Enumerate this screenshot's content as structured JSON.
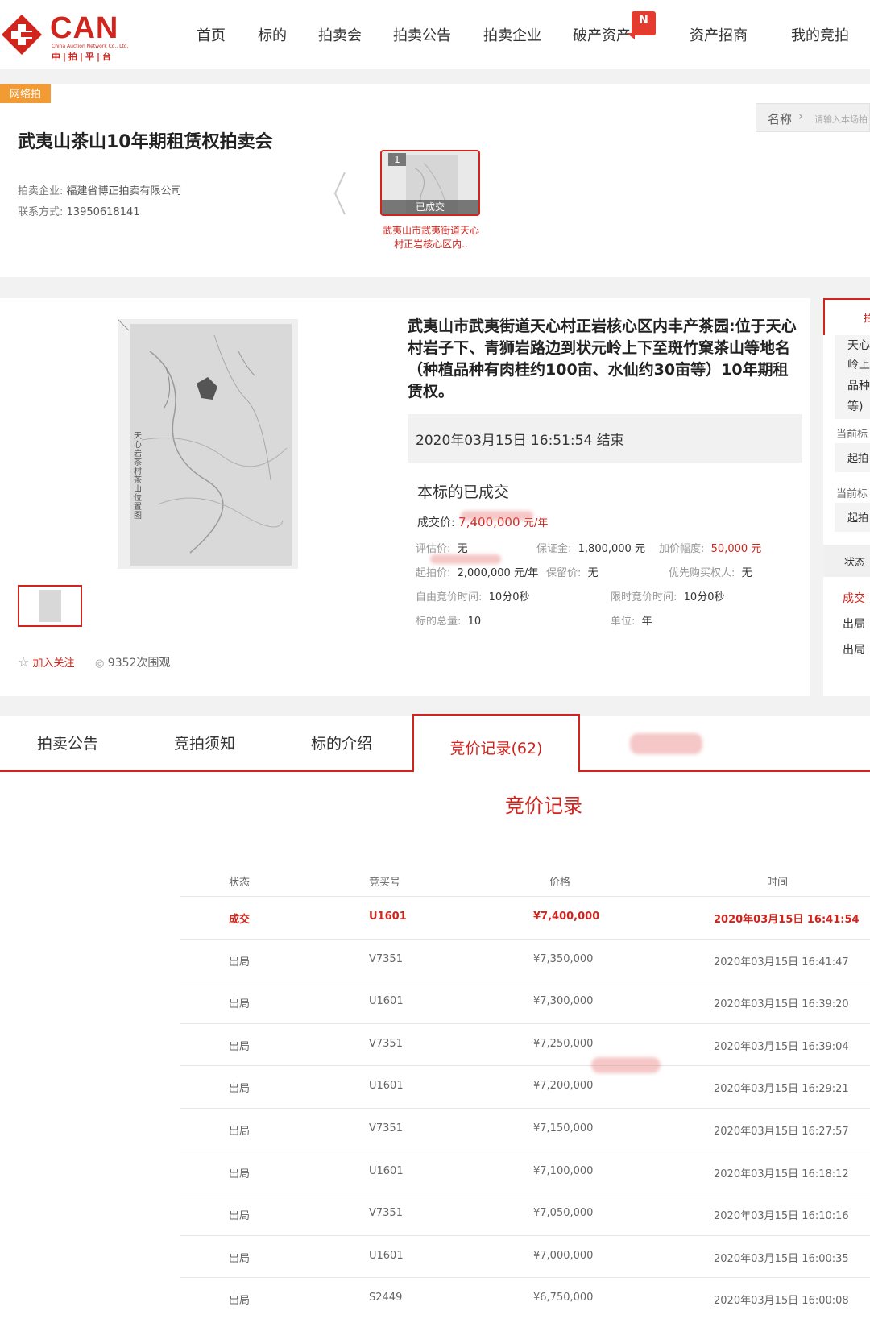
{
  "header": {
    "logo_text": "CAN",
    "logo_sub": "China Auction Network Co., Ltd.",
    "logo_cn": "中|拍|平|台",
    "nav": [
      "首页",
      "标的",
      "拍卖会",
      "拍卖公告",
      "拍卖企业",
      "破产资产",
      "资产招商",
      "我的竞拍"
    ],
    "badge": "N"
  },
  "auction": {
    "tag": "网络拍",
    "title": "武夷山茶山10年期租赁权拍卖会",
    "company_label": "拍卖企业:",
    "company": "福建省博正拍卖有限公司",
    "contact_label": "联系方式:",
    "contact": "13950618141",
    "search_label": "名称",
    "search_placeholder": "请输入本场拍",
    "lot_no": "1",
    "lot_status": "已成交",
    "lot_caption": "武夷山市武夷街道天心村正岩核心区内.."
  },
  "item": {
    "image_caption": "天心岩茶村茶山位置图",
    "follow": "加入关注",
    "views": "9352次围观",
    "title": "武夷山市武夷街道天心村正岩核心区内丰产茶园:位于天心村岩子下、青狮岩路边到状元岭上下至斑竹窠茶山等地名（种植品种有肉桂约100亩、水仙约30亩等）10年期租赁权。",
    "end_time": "2020年03月15日  16:51:54 结束",
    "sold_heading": "本标的已成交",
    "deal_label": "成交价:",
    "deal_value": "7,400,000",
    "deal_unit": "元/年",
    "fields": {
      "eval_k": "评估价:",
      "eval_v": "无",
      "deposit_k": "保证金:",
      "deposit_v": "1,800,000 元",
      "step_k": "加价幅度:",
      "step_v": "50,000 元",
      "start_k": "起拍价:",
      "start_v": "2,000,000 元/年",
      "reserve_k": "保留价:",
      "reserve_v": "无",
      "priority_k": "优先购买权人:",
      "priority_v": "无",
      "free_k": "自由竞价时间:",
      "free_v": "10分0秒",
      "limit_k": "限时竞价时间:",
      "limit_v": "10分0秒",
      "total_k": "标的总量:",
      "total_v": "10",
      "unit_k": "单位:",
      "unit_v": "年"
    }
  },
  "side": {
    "top": "拍",
    "box_lines": [
      "天心",
      "岭上",
      "品种",
      "等)"
    ],
    "label1": "当前标",
    "val1": "起拍",
    "label2": "当前标",
    "val2": "起拍",
    "state": "状态",
    "s1": "成交",
    "s2": "出局",
    "s3": "出局"
  },
  "tabs": [
    "拍卖公告",
    "竞拍须知",
    "标的介绍",
    "竞价记录(62)"
  ],
  "records": {
    "title": "竞价记录",
    "headers": [
      "状态",
      "竞买号",
      "价格",
      "时间"
    ],
    "rows": [
      {
        "status": "成交",
        "id": "U1601",
        "price": "¥7,400,000",
        "time": "2020年03月15日  16:41:54"
      },
      {
        "status": "出局",
        "id": "V7351",
        "price": "¥7,350,000",
        "time": "2020年03月15日  16:41:47"
      },
      {
        "status": "出局",
        "id": "U1601",
        "price": "¥7,300,000",
        "time": "2020年03月15日  16:39:20"
      },
      {
        "status": "出局",
        "id": "V7351",
        "price": "¥7,250,000",
        "time": "2020年03月15日  16:39:04"
      },
      {
        "status": "出局",
        "id": "U1601",
        "price": "¥7,200,000",
        "time": "2020年03月15日  16:29:21"
      },
      {
        "status": "出局",
        "id": "V7351",
        "price": "¥7,150,000",
        "time": "2020年03月15日  16:27:57"
      },
      {
        "status": "出局",
        "id": "U1601",
        "price": "¥7,100,000",
        "time": "2020年03月15日  16:18:12"
      },
      {
        "status": "出局",
        "id": "V7351",
        "price": "¥7,050,000",
        "time": "2020年03月15日  16:10:16"
      },
      {
        "status": "出局",
        "id": "U1601",
        "price": "¥7,000,000",
        "time": "2020年03月15日  16:00:35"
      },
      {
        "status": "出局",
        "id": "S2449",
        "price": "¥6,750,000",
        "time": "2020年03月15日  16:00:08"
      }
    ]
  },
  "colors": {
    "brand": "#d0241c",
    "tag": "#f29a33"
  }
}
